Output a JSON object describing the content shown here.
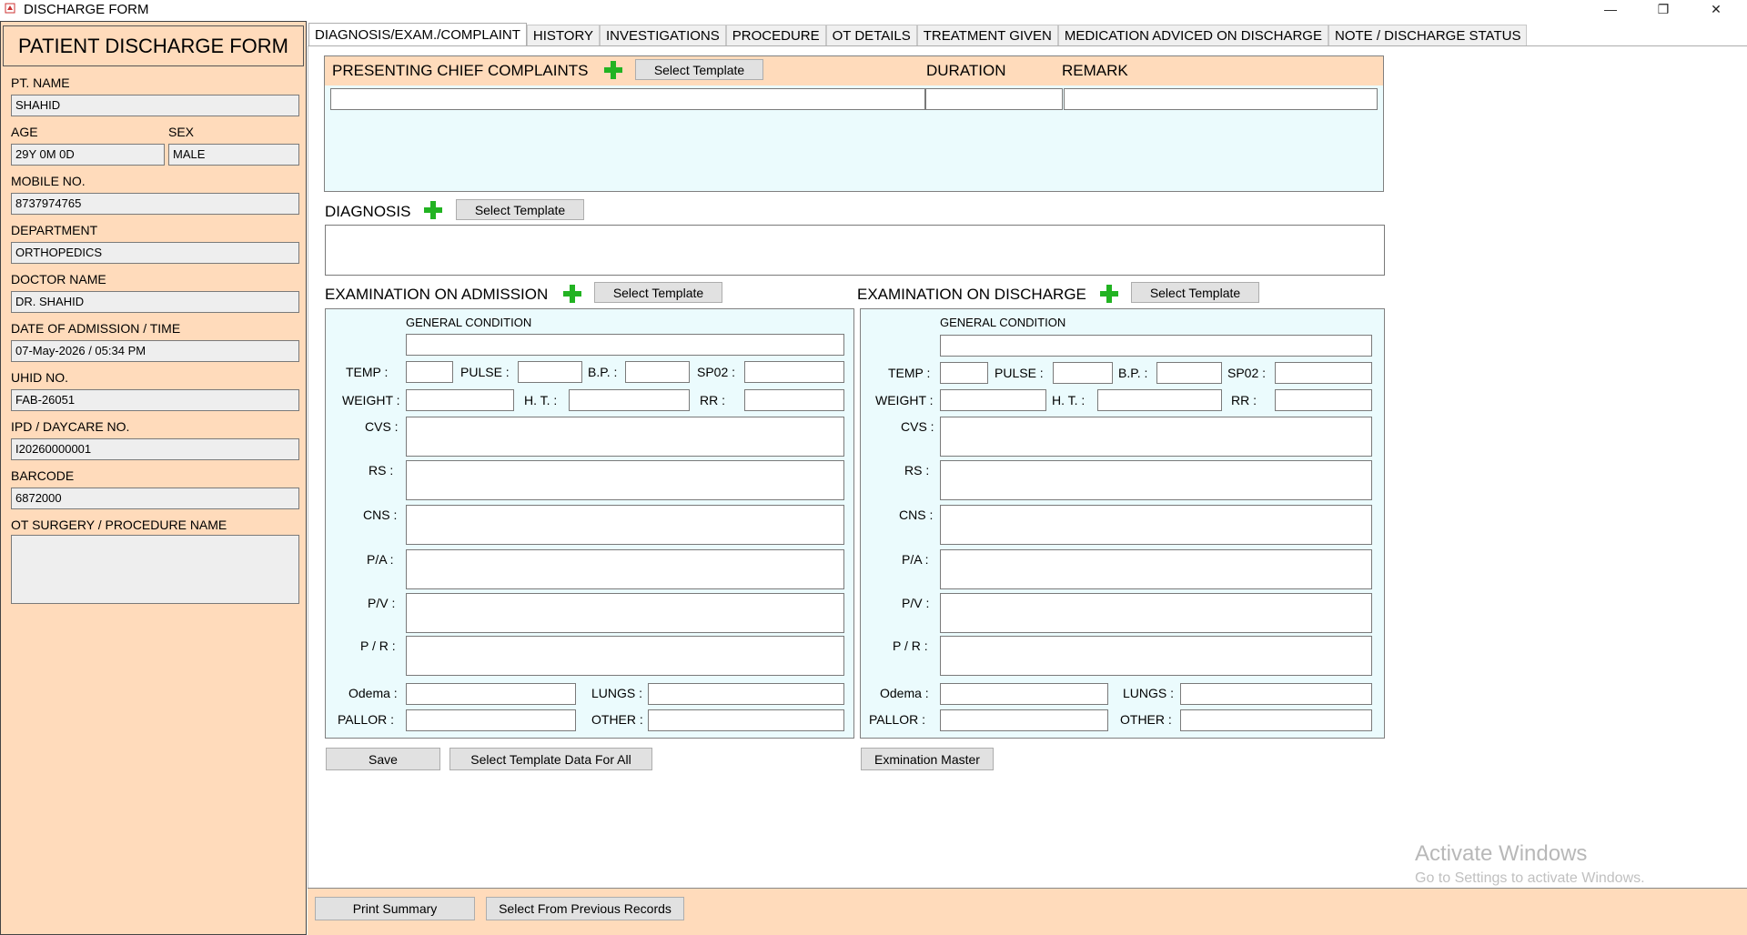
{
  "window": {
    "title": "DISCHARGE FORM",
    "icon": "app-icon",
    "controls": {
      "minimize": "—",
      "restore": "❐",
      "close": "✕"
    }
  },
  "patient": {
    "form_title": "PATIENT DISCHARGE FORM",
    "name_label": "PT. NAME",
    "name": "SHAHID",
    "age_label": "AGE",
    "age": "29Y 0M 0D",
    "sex_label": "SEX",
    "sex": "MALE",
    "mobile_label": "MOBILE NO.",
    "mobile": "8737974765",
    "department_label": "DEPARTMENT",
    "department": "ORTHOPEDICS",
    "doctor_label": "DOCTOR NAME",
    "doctor": "DR. SHAHID",
    "admission_label": "DATE OF ADMISSION / TIME",
    "admission": "07-May-2026 / 05:34 PM",
    "uhid_label": "UHID NO.",
    "uhid": "FAB-26051",
    "ipd_label": "IPD / DAYCARE NO.",
    "ipd": "I20260000001",
    "barcode_label": "BARCODE",
    "barcode": "6872000",
    "ot_label": "OT SURGERY / PROCEDURE NAME",
    "ot": ""
  },
  "tabs": [
    {
      "label": "DIAGNOSIS/EXAM./COMPLAINT",
      "active": true
    },
    {
      "label": "HISTORY"
    },
    {
      "label": "INVESTIGATIONS"
    },
    {
      "label": "PROCEDURE"
    },
    {
      "label": "OT DETAILS"
    },
    {
      "label": "TREATMENT GIVEN"
    },
    {
      "label": "MEDICATION ADVICED ON DISCHARGE"
    },
    {
      "label": "NOTE / DISCHARGE STATUS"
    }
  ],
  "complaints": {
    "title": "PRESENTING CHIEF COMPLAINTS",
    "template_btn": "Select Template",
    "duration_label": "DURATION",
    "remark_label": "REMARK"
  },
  "diagnosis": {
    "title": "DIAGNOSIS",
    "template_btn": "Select Template"
  },
  "exam_admission": {
    "title": "EXAMINATION ON ADMISSION",
    "template_btn": "Select Template"
  },
  "exam_discharge": {
    "title": "EXAMINATION ON DISCHARGE",
    "template_btn": "Select Template"
  },
  "exam_labels": {
    "general_condition": "GENERAL CONDITION",
    "temp": "TEMP :",
    "pulse": "PULSE :",
    "bp": "B.P. :",
    "spo2": "SP02 :",
    "weight": "WEIGHT :",
    "ht": "H. T. :",
    "rr": "RR :",
    "cvs": "CVS :",
    "rs": "RS :",
    "cns": "CNS :",
    "pa": "P/A :",
    "pv": "P/V :",
    "pr": "P / R :",
    "odema": "Odema :",
    "lungs": "LUNGS :",
    "pallor": "PALLOR :",
    "other": "OTHER :"
  },
  "actions": {
    "save": "Save",
    "select_all": "Select Template Data For All",
    "exam_master": "Exmination Master",
    "print_summary": "Print Summary",
    "previous_records": "Select From Previous Records"
  },
  "watermark": {
    "line1": "Activate Windows",
    "line2": "Go to Settings to activate Windows."
  }
}
